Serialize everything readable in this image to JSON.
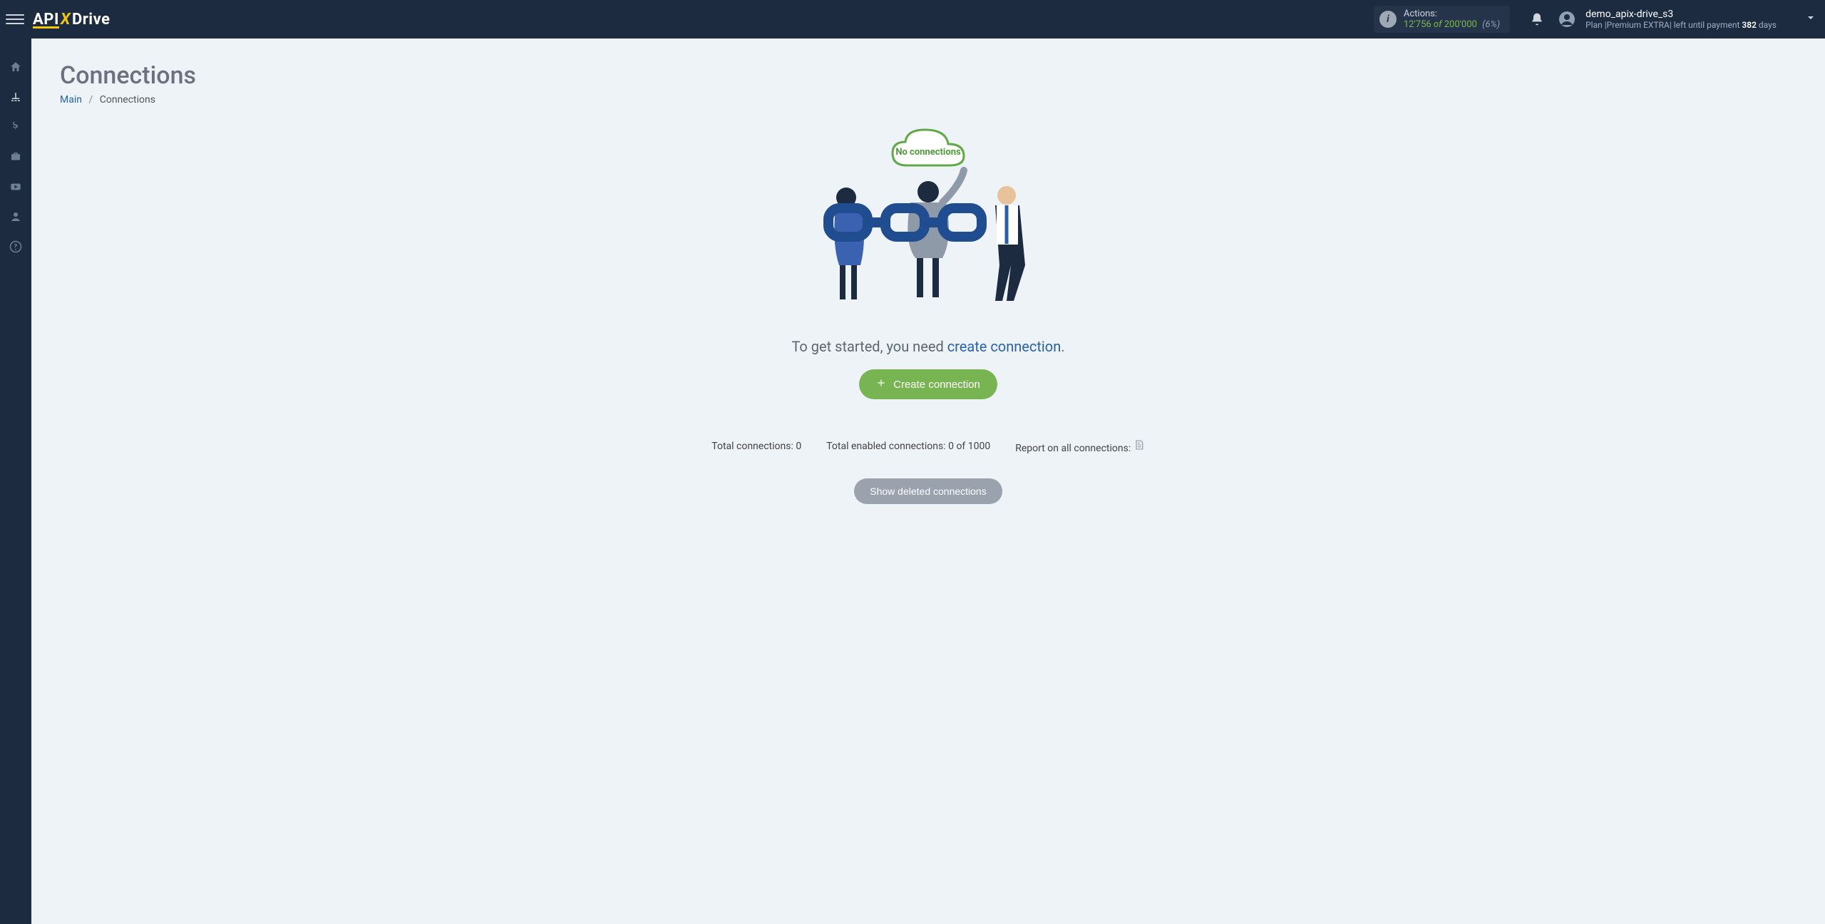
{
  "header": {
    "logo": {
      "part1": "API",
      "part2": "X",
      "part3": "Drive"
    },
    "actions": {
      "label": "Actions:",
      "used": "12'756",
      "of": "of",
      "total": "200'000",
      "percent": "(6%)"
    },
    "user": {
      "name": "demo_apix-drive_s3",
      "plan_prefix": "Plan |",
      "plan_name": "Premium EXTRA",
      "plan_suffix": "| left until payment ",
      "days": "382",
      "days_word": " days"
    }
  },
  "sidebar": {
    "items": [
      {
        "name": "home"
      },
      {
        "name": "connections"
      },
      {
        "name": "billing"
      },
      {
        "name": "briefcase"
      },
      {
        "name": "video"
      },
      {
        "name": "account"
      },
      {
        "name": "help"
      }
    ]
  },
  "page": {
    "title": "Connections",
    "breadcrumb": {
      "main": "Main",
      "current": "Connections"
    }
  },
  "empty": {
    "cloud_text": "No connections",
    "line_prefix": "To get started, you need ",
    "line_link": "create connection",
    "line_suffix": ".",
    "button": "Create connection"
  },
  "stats": {
    "total_label": "Total connections:",
    "total_value": "0",
    "enabled_label": "Total enabled connections:",
    "enabled_value": "0 of 1000",
    "report_label": "Report on all connections:"
  },
  "buttons": {
    "show_deleted": "Show deleted connections"
  }
}
